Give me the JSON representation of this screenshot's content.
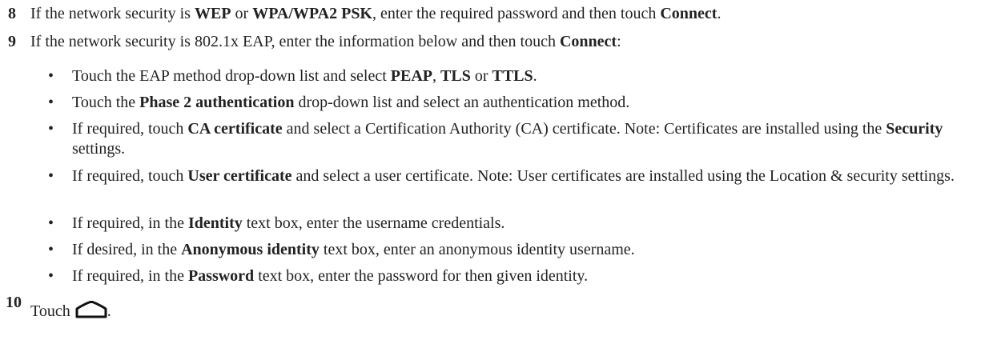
{
  "steps": [
    {
      "number": "8",
      "parts": [
        {
          "text": "If the network security is ",
          "bold": false
        },
        {
          "text": "WEP",
          "bold": true
        },
        {
          "text": " or ",
          "bold": false
        },
        {
          "text": "WPA/WPA2 PSK",
          "bold": true
        },
        {
          "text": ", enter the required password and then touch ",
          "bold": false
        },
        {
          "text": "Connect",
          "bold": true
        },
        {
          "text": ".",
          "bold": false
        }
      ]
    },
    {
      "number": "9",
      "parts": [
        {
          "text": "If the network security is 802.1x EAP, enter the information below and then touch ",
          "bold": false
        },
        {
          "text": "Connect",
          "bold": true
        },
        {
          "text": ":",
          "bold": false
        }
      ]
    }
  ],
  "bullet_char": "•",
  "bullets": [
    {
      "parts": [
        {
          "text": "Touch the EAP method drop-down list and select ",
          "bold": false
        },
        {
          "text": "PEAP",
          "bold": true
        },
        {
          "text": ", ",
          "bold": false
        },
        {
          "text": "TLS",
          "bold": true
        },
        {
          "text": " or ",
          "bold": false
        },
        {
          "text": "TTLS",
          "bold": true
        },
        {
          "text": ".",
          "bold": false
        }
      ]
    },
    {
      "parts": [
        {
          "text": "Touch the ",
          "bold": false
        },
        {
          "text": "Phase 2 authentication",
          "bold": true
        },
        {
          "text": " drop-down list and select an authentication method.",
          "bold": false
        }
      ]
    },
    {
      "parts": [
        {
          "text": "If required, touch ",
          "bold": false
        },
        {
          "text": "CA certificate",
          "bold": true
        },
        {
          "text": " and select a Certification Authority (CA) certificate. Note: Certificates are installed using the ",
          "bold": false
        },
        {
          "text": "Security",
          "bold": true
        },
        {
          "text": " settings.",
          "bold": false
        }
      ]
    },
    {
      "parts": [
        {
          "text": "If required, touch ",
          "bold": false
        },
        {
          "text": "User certificate",
          "bold": true
        },
        {
          "text": " and select a user certificate. Note: User certificates are installed using the Location & security settings.",
          "bold": false
        }
      ]
    },
    {
      "parts": [
        {
          "text": "If required, in the ",
          "bold": false
        },
        {
          "text": "Identity",
          "bold": true
        },
        {
          "text": " text box, enter the username credentials.",
          "bold": false
        }
      ]
    },
    {
      "parts": [
        {
          "text": "If desired, in the ",
          "bold": false
        },
        {
          "text": "Anonymous identity",
          "bold": true
        },
        {
          "text": " text box, enter an anonymous identity username.",
          "bold": false
        }
      ]
    },
    {
      "parts": [
        {
          "text": "If required, in the ",
          "bold": false
        },
        {
          "text": "Password",
          "bold": true
        },
        {
          "text": " text box, enter the password for then given identity.",
          "bold": false
        }
      ]
    }
  ],
  "final_step": {
    "number": "10",
    "text": "Touch",
    "trailing": ".",
    "icon": "home-icon"
  }
}
